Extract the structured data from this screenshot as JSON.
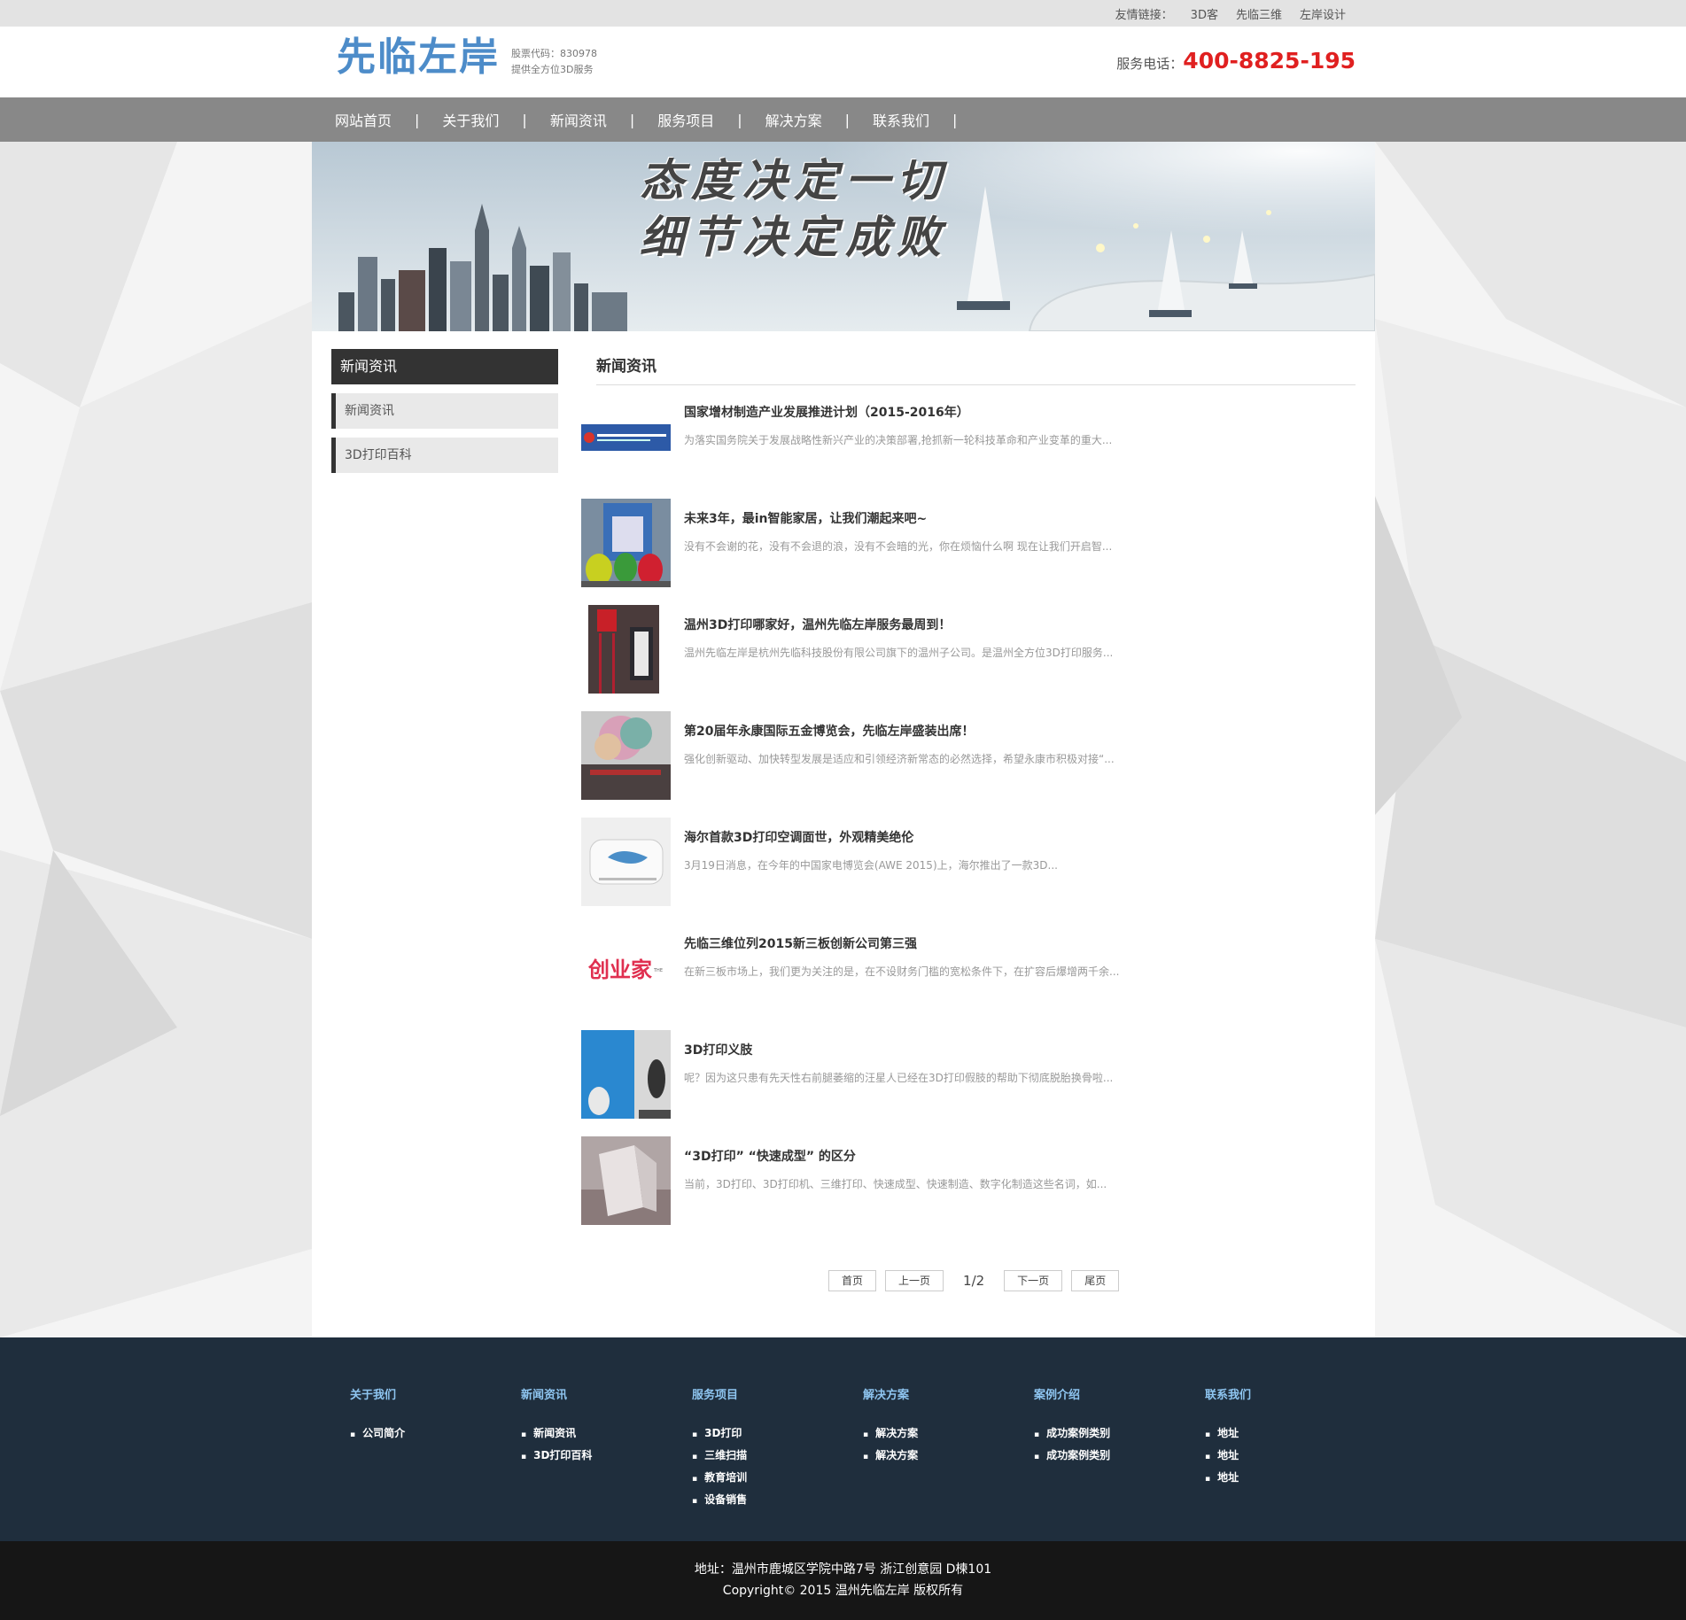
{
  "topbar": {
    "label": "友情链接：",
    "links": [
      "3D客",
      "先临三维",
      "左岸设计"
    ]
  },
  "header": {
    "logo": "先临左岸",
    "stock_code": "股票代码：830978",
    "stock_slogan": "提供全方位3D服务",
    "phone_label": "服务电话：",
    "phone_number": "400-8825-195"
  },
  "nav": [
    "网站首页",
    "关于我们",
    "新闻资讯",
    "服务项目",
    "解决方案",
    "联系我们"
  ],
  "nav_separator": "|",
  "banner": {
    "line1": "态度决定一切",
    "line2": "细节决定成败"
  },
  "sidebar": {
    "title": "新闻资讯",
    "items": [
      "新闻资讯",
      "3D打印百科"
    ]
  },
  "content": {
    "title": "新闻资讯",
    "news": [
      {
        "title": "国家增材制造产业发展推进计划（2015-2016年）",
        "desc": "为落实国务院关于发展战略性新兴产业的决策部署,抢抓新一轮科技革命和产业变革的重大...",
        "thumb": "government-document"
      },
      {
        "title": "未来3年，最in智能家居，让我们潮起来吧~",
        "desc": "没有不会谢的花，没有不会退的浪，没有不会暗的光，你在烦恼什么啊 现在让我们开启智...",
        "thumb": "3d-printer-figures"
      },
      {
        "title": "温州3D打印哪家好，温州先临左岸服务最周到！",
        "desc": "温州先临左岸是杭州先临科技股份有限公司旗下的温州子公司。是温州全方位3D打印服务...",
        "thumb": "store-sign"
      },
      {
        "title": "第20届年永康国际五金博览会，先临左岸盛装出席！",
        "desc": "强化创新驱动、加快转型发展是适应和引领经济新常态的必然选择，希望永康市积极对接“...",
        "thumb": "expo-photo"
      },
      {
        "title": "海尔首款3D打印空调面世，外观精美绝伦",
        "desc": "3月19日消息，在今年的中国家电博览会(AWE 2015)上，海尔推出了一款3D...",
        "thumb": "air-conditioner"
      },
      {
        "title": "先临三维位列2015新三板创新公司第三强",
        "desc": "在新三板市场上，我们更为关注的是，在不设财务门槛的宽松条件下，在扩容后爆增两千余...",
        "thumb": "chuangyejia-logo"
      },
      {
        "title": "3D打印义肢",
        "desc": "呢？因为这只患有先天性右前腿萎缩的汪星人已经在3D打印假肢的帮助下彻底脱胎换骨啦...",
        "thumb": "dog-prosthesis"
      },
      {
        "title": "“3D打印” “快速成型” 的区分",
        "desc": "当前，3D打印、3D打印机、三维打印、快速成型、快速制造、数字化制造这些名词，如...",
        "thumb": "printed-chair"
      }
    ]
  },
  "pager": {
    "first": "首页",
    "prev": "上一页",
    "current": "1/2",
    "next": "下一页",
    "last": "尾页"
  },
  "footer": {
    "columns": [
      {
        "title": "关于我们",
        "items": [
          "公司简介"
        ]
      },
      {
        "title": "新闻资讯",
        "items": [
          "新闻资讯",
          "3D打印百科"
        ]
      },
      {
        "title": "服务项目",
        "items": [
          "3D打印",
          "三维扫描",
          "教育培训",
          "设备销售"
        ]
      },
      {
        "title": "解决方案",
        "items": [
          "解决方案",
          "解决方案"
        ]
      },
      {
        "title": "案例介绍",
        "items": [
          "成功案例类别",
          "成功案例类别"
        ]
      },
      {
        "title": "联系我们",
        "items": [
          "地址",
          "地址",
          "地址"
        ]
      }
    ],
    "address": "地址：温州市鹿城区学院中路7号 浙江创意园 D楝101",
    "copyright": "Copyright© 2015 温州先临左岸 版权所有"
  },
  "colors": {
    "accent_red": "#e02020",
    "logo_blue": "#4d8cc9",
    "footer_bg": "#1f2e3d",
    "footer_head": "#8ec5f0",
    "nav_bg": "#888888"
  }
}
